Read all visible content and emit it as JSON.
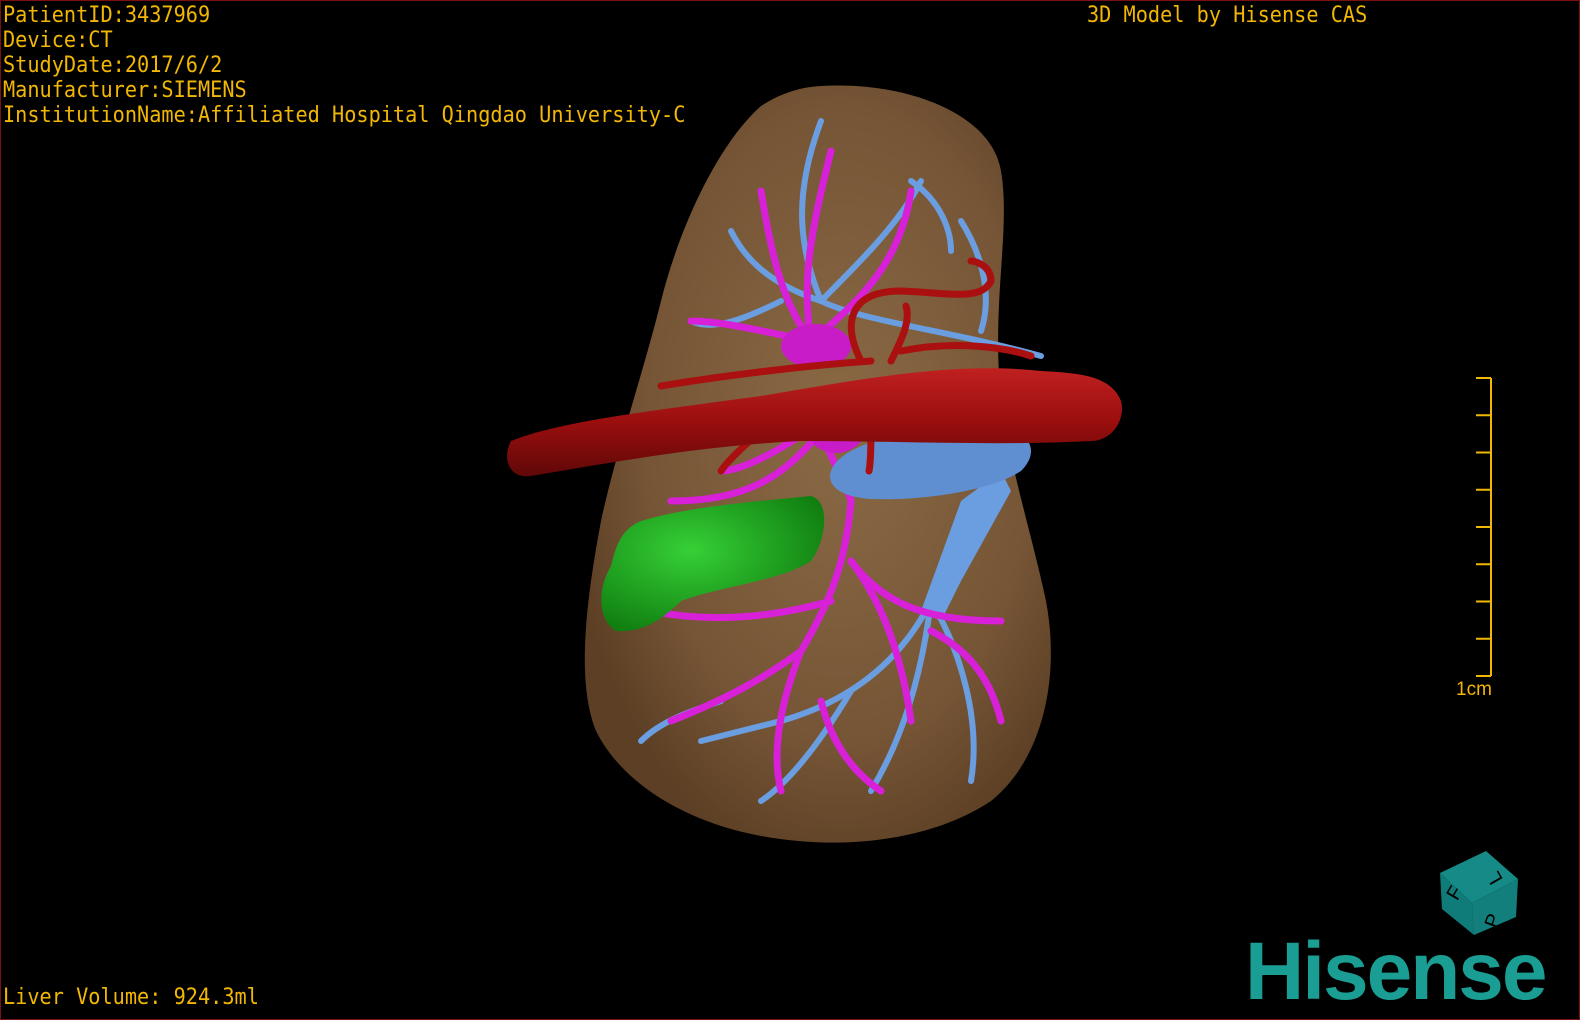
{
  "overlay": {
    "patient_id": "PatientID:3437969",
    "device": "Device:CT",
    "study_date": "StudyDate:2017/6/2",
    "manufacturer": "Manufacturer:SIEMENS",
    "institution": "InstitutionName:Affiliated Hospital Qingdao University-C",
    "title": "3D Model by Hisense CAS",
    "liver_volume": "Liver Volume: 924.3ml"
  },
  "scale_bar": {
    "label": "1cm",
    "ticks": 9
  },
  "orientation_cube": {
    "labels": [
      "F",
      "L",
      "P"
    ],
    "color": "#0f7c7a"
  },
  "logo": {
    "text": "Hisense",
    "color": "#1a9e93"
  },
  "model_colors": {
    "liver": "#7a5a38",
    "portal_vein": "#d820d8",
    "hepatic_vein": "#6a9ee0",
    "vena_cava": "#aa1010",
    "tumor": "#1ea01e",
    "text": "#f2b705"
  }
}
